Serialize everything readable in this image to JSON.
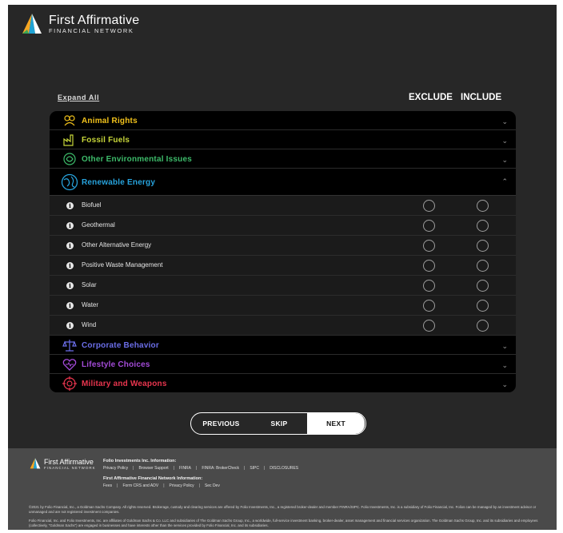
{
  "brand": {
    "name": "First Affirmative",
    "subtitle": "FINANCIAL NETWORK"
  },
  "controls": {
    "expand_all": "Expand All",
    "exclude_header": "EXCLUDE",
    "include_header": "INCLUDE"
  },
  "categories_top": [
    {
      "label": "Animal Rights",
      "icon": "animal-icon",
      "color": "#f2c21b"
    },
    {
      "label": "Fossil Fuels",
      "icon": "factory-icon",
      "color": "#c7d63a"
    },
    {
      "label": "Other Environmental Issues",
      "icon": "environment-icon",
      "color": "#3dbb6a"
    }
  ],
  "expanded": {
    "label": "Renewable Energy",
    "icon": "globe-icon",
    "color": "#27a3dd"
  },
  "subitems": [
    {
      "label": "Biofuel"
    },
    {
      "label": "Geothermal"
    },
    {
      "label": "Other Alternative Energy"
    },
    {
      "label": "Positive Waste Management"
    },
    {
      "label": "Solar"
    },
    {
      "label": "Water"
    },
    {
      "label": "Wind"
    }
  ],
  "categories_bottom": [
    {
      "label": "Corporate Behavior",
      "icon": "scales-icon",
      "color": "#6b6ee8"
    },
    {
      "label": "Lifestyle Choices",
      "icon": "heart-icon",
      "color": "#a44bd9"
    },
    {
      "label": "Military and Weapons",
      "icon": "target-icon",
      "color": "#e8354e"
    }
  ],
  "nav": {
    "previous": "PREVIOUS",
    "skip": "SKIP",
    "next": "NEXT"
  },
  "footer": {
    "brand_name": "First Affirmative",
    "brand_sub": "FINANCIAL NETWORK",
    "folio_heading": "Folio Investments Inc. Information:",
    "folio_links": [
      "Privacy Policy",
      "Browser Support",
      "FINRA",
      "FINRA: BrokerCheck",
      "SIPC",
      "DISCLOSURES"
    ],
    "fafn_heading": "First Affirmative Financial Network Information:",
    "fafn_links": [
      "Fees",
      "Form CRS and ADV",
      "Privacy Policy",
      "Sec Dev"
    ],
    "legal1": "©2021 by Folio Financial, Inc., a Goldman Sachs Company. All rights reserved. Brokerage, custody and clearing services are offered by Folio Investments, Inc., a registered broker-dealer and member FINRA/SIPC. Folio Investments, Inc. is a subsidiary of Folio Financial, Inc. Folios can be managed by an investment advisor or unmanaged and are not registered investment companies.",
    "legal2": "Folio Financial, Inc. and Folio Investments, Inc. are affiliates of Goldman Sachs & Co. LLC and subsidiaries of The Goldman Sachs Group, Inc., a worldwide, full-service investment banking, broker-dealer, asset management and financial services organization. The Goldman Sachs Group, Inc. and its subsidiaries and employees (collectively, \"Goldman Sachs\") are engaged in businesses and have interests other than the services provided by Folio Financial, Inc. and its subsidiaries."
  }
}
